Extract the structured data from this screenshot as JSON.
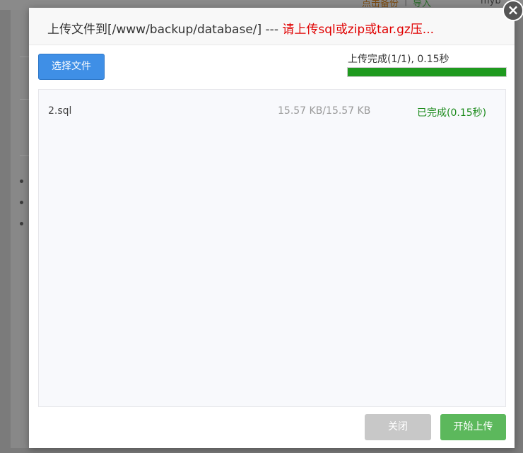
{
  "background": {
    "top_links": [
      "点击备份",
      "|",
      "导入"
    ],
    "top_right": "myb"
  },
  "dialog": {
    "title_prefix": "上传文件到[/www/backup/database/] --- ",
    "title_warning": "请上传sql或zip或tar.gz压...",
    "select_button": "选择文件",
    "progress_text": "上传完成(1/1), 0.15秒",
    "progress_fraction": 1.0,
    "files": [
      {
        "name": "2.sql",
        "size": "15.57 KB/15.57 KB",
        "status": "已完成(0.15秒)"
      }
    ],
    "close_button": "关闭",
    "start_button": "开始上传",
    "close_icon": "×"
  },
  "colors": {
    "progress": "#1f9a1f",
    "primary_button": "#3f8fe6",
    "start_button": "#5cb85c",
    "warning_text": "#e00000",
    "status_text": "#1a8a1a"
  }
}
